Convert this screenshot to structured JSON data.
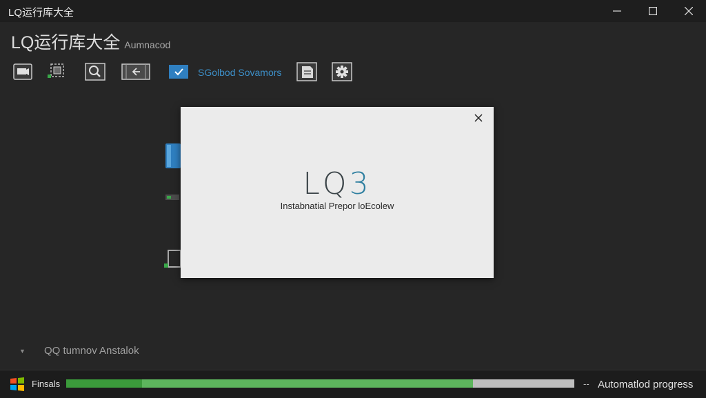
{
  "window": {
    "title": "LQ运行库大全",
    "controls": [
      "minimize",
      "maximize",
      "close"
    ]
  },
  "header": {
    "title": "LQ运行库大全",
    "subtitle": "Aumnacod"
  },
  "toolbar": {
    "buttons": [
      {
        "icon": "screen-icon"
      },
      {
        "icon": "component-icon"
      },
      {
        "icon": "search-icon"
      },
      {
        "icon": "package-icon"
      },
      {
        "icon": "check-icon"
      },
      {
        "icon": "document-icon"
      },
      {
        "icon": "gear-icon"
      }
    ],
    "select_label": "SGolbod Sovamors"
  },
  "dialog": {
    "logo_main": "LQ",
    "logo_accent": "3",
    "subtitle": "Instabnatial Prepor loEcolew"
  },
  "tree": {
    "item_label": "QQ tumnov Anstalok"
  },
  "status": {
    "label": "Finsals",
    "separator": "--",
    "progress": 0.8,
    "text": "Automatlod progress"
  },
  "colors": {
    "accent": "#3d8fc8",
    "progress": "#5db65d",
    "background": "#262626"
  }
}
